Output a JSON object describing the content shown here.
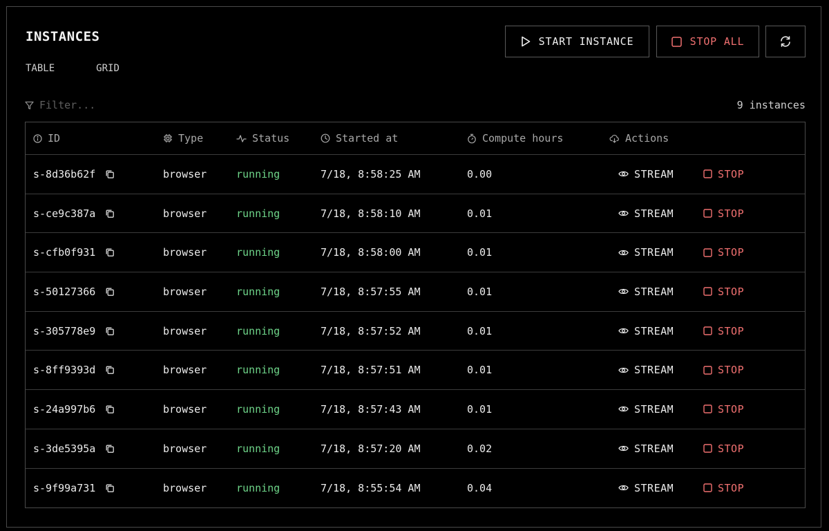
{
  "header": {
    "title": "INSTANCES",
    "view_tabs": [
      "TABLE",
      "GRID"
    ],
    "start_label": "START INSTANCE",
    "stop_all_label": "STOP ALL"
  },
  "filter": {
    "placeholder": "Filter...",
    "value": ""
  },
  "instance_count": "9 instances",
  "columns": [
    "ID",
    "Type",
    "Status",
    "Started at",
    "Compute hours",
    "Actions"
  ],
  "actions": {
    "stream_label": "STREAM",
    "stop_label": "STOP"
  },
  "rows": [
    {
      "id": "s-8d36b62f",
      "type": "browser",
      "status": "running",
      "started": "7/18, 8:58:25 AM",
      "hours": "0.00"
    },
    {
      "id": "s-ce9c387a",
      "type": "browser",
      "status": "running",
      "started": "7/18, 8:58:10 AM",
      "hours": "0.01"
    },
    {
      "id": "s-cfb0f931",
      "type": "browser",
      "status": "running",
      "started": "7/18, 8:58:00 AM",
      "hours": "0.01"
    },
    {
      "id": "s-50127366",
      "type": "browser",
      "status": "running",
      "started": "7/18, 8:57:55 AM",
      "hours": "0.01"
    },
    {
      "id": "s-305778e9",
      "type": "browser",
      "status": "running",
      "started": "7/18, 8:57:52 AM",
      "hours": "0.01"
    },
    {
      "id": "s-8ff9393d",
      "type": "browser",
      "status": "running",
      "started": "7/18, 8:57:51 AM",
      "hours": "0.01"
    },
    {
      "id": "s-24a997b6",
      "type": "browser",
      "status": "running",
      "started": "7/18, 8:57:43 AM",
      "hours": "0.01"
    },
    {
      "id": "s-3de5395a",
      "type": "browser",
      "status": "running",
      "started": "7/18, 8:57:20 AM",
      "hours": "0.02"
    },
    {
      "id": "s-9f99a731",
      "type": "browser",
      "status": "running",
      "started": "7/18, 8:55:54 AM",
      "hours": "0.04"
    }
  ],
  "colors": {
    "background": "#000000",
    "running": "#6fd68a",
    "danger": "#f07070",
    "border": "#4a4a4a"
  }
}
